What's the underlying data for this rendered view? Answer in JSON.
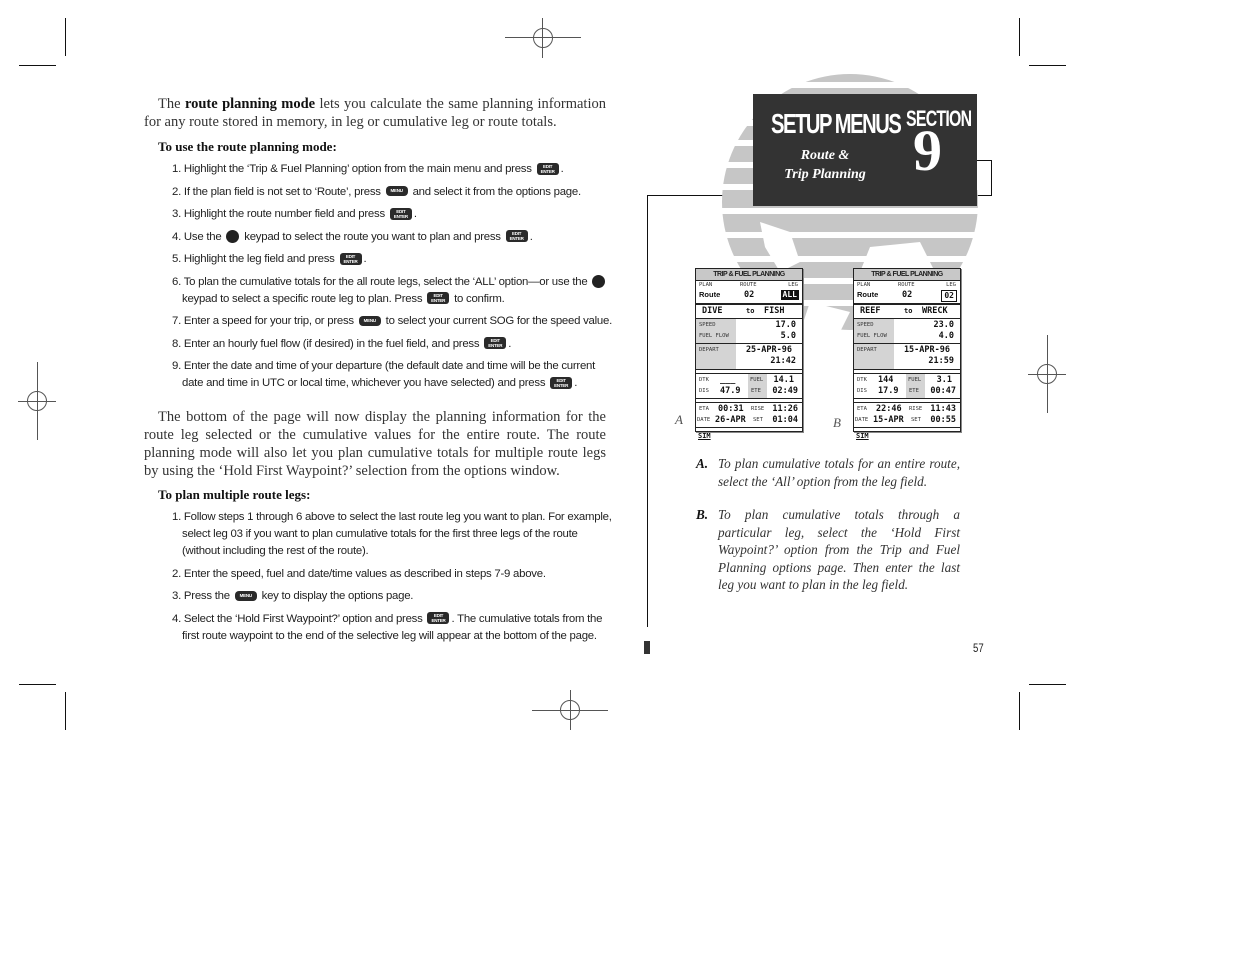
{
  "left_page": {
    "intro": {
      "prefix": "The ",
      "bold": "route planning mode",
      "suffix": " lets you calculate the same planning information for any route stored in memory, in leg or cumulative leg or route totals."
    },
    "use_heading": "To use the route planning mode:",
    "use_steps": [
      {
        "num": "1.",
        "parts": [
          "Highlight the ‘Trip & Fuel Planning’ option from the main menu and press ",
          "{EDIT}",
          "."
        ]
      },
      {
        "num": "2.",
        "parts": [
          "If the plan field is not set to ‘Route’, press ",
          "{MENU}",
          " and select it from the options page."
        ]
      },
      {
        "num": "3.",
        "parts": [
          "Highlight the route number field and press ",
          "{EDIT}",
          "."
        ]
      },
      {
        "num": "4.",
        "parts": [
          "Use the ",
          "{PAD}",
          " keypad to select the route you want to plan and press ",
          "{EDIT}",
          "."
        ]
      },
      {
        "num": "5.",
        "parts": [
          "Highlight the leg field and press ",
          "{EDIT}",
          "."
        ]
      },
      {
        "num": "6.",
        "parts": [
          "To plan the cumulative totals for the all route legs, select the ‘ALL’ option—or use the ",
          "{PAD}",
          " keypad to select a specific route leg to plan. Press ",
          "{EDIT}",
          " to confirm."
        ]
      },
      {
        "num": "7.",
        "parts": [
          "Enter a speed for your trip, or press ",
          "{MENU}",
          " to select your current SOG for the speed value."
        ]
      },
      {
        "num": "8.",
        "parts": [
          "Enter an hourly fuel flow (if desired) in the fuel field, and press ",
          "{EDIT}",
          "."
        ]
      },
      {
        "num": "9.",
        "parts": [
          "Enter the date and time of your departure (the default date and time will be the current date and time in UTC or local time, whichever you have selected) and press ",
          "{EDIT}",
          "."
        ]
      }
    ],
    "para2": "The bottom of the page will now display the planning information for the route leg selected or the cumulative values for the entire route. The route planning mode will also let you plan cumulative totals for multiple route legs by using the ‘Hold First Waypoint?’ selection from the options window.",
    "multi_heading": "To plan multiple route legs:",
    "multi_steps": [
      {
        "num": "1.",
        "parts": [
          "Follow steps 1 through 6 above to select the last route leg you want to plan. For example, select leg 03 if you want to plan cumulative totals for the first three legs of the route (without including the rest of the route)."
        ]
      },
      {
        "num": "2.",
        "parts": [
          "Enter the speed, fuel and date/time values as described in steps 7-9 above."
        ]
      },
      {
        "num": "3.",
        "parts": [
          "Press the ",
          "{MENU}",
          " key to display the options page."
        ]
      },
      {
        "num": "4.",
        "parts": [
          "Select the ‘Hold First Waypoint?’ option and press ",
          "{EDIT}",
          ". The cumulative totals from the first route waypoint to the end of the selective leg will appear at the bottom of the page."
        ]
      }
    ],
    "keys": {
      "edit_top": "EDIT",
      "edit_bottom": "ENTER",
      "menu": "MENU"
    }
  },
  "section_header": {
    "title": "SETUP MENUS",
    "subtitle_line1": "Route &",
    "subtitle_line2": "Trip Planning",
    "section_label": "SECTION",
    "section_number": "9"
  },
  "screens": [
    {
      "letter": "A",
      "title": "TRIP & FUEL PLANNING",
      "plan_label": "PLAN",
      "route_label": "ROUTE",
      "leg_label": "LEG",
      "plan_value": "Route",
      "route_value": "02",
      "leg_value": "ALL",
      "from": "DIVE",
      "to_word": "to",
      "to": "FISH",
      "speed_label": "SPEED",
      "speed_value": "17.0",
      "fuel_flow_label": "FUEL FLOW",
      "fuel_flow_value": "5.0",
      "depart_label": "DEPART",
      "depart_date": "25-APR-96",
      "depart_time": "21:42",
      "dtk_label": "DTK",
      "dtk_value": "___",
      "dis_label": "DIS",
      "dis_value": "47.9",
      "fuel_label": "FUEL",
      "fuel_value": "14.1",
      "ete_label": "ETE",
      "ete_value": "02:49",
      "eta_label": "ETA",
      "eta_value": "00:31",
      "date_label": "DATE",
      "date_value": "26-APR",
      "rise_label": "RISE",
      "rise_value": "11:26",
      "set_label": "SET",
      "set_value": "01:04",
      "status": "SIM"
    },
    {
      "letter": "B",
      "title": "TRIP & FUEL PLANNING",
      "plan_label": "PLAN",
      "route_label": "ROUTE",
      "leg_label": "LEG",
      "plan_value": "Route",
      "route_value": "02",
      "leg_value": "02",
      "from": "REEF",
      "to_word": "to",
      "to": "WRECK",
      "speed_label": "SPEED",
      "speed_value": "23.0",
      "fuel_flow_label": "FUEL FLOW",
      "fuel_flow_value": "4.0",
      "depart_label": "DEPART",
      "depart_date": "15-APR-96",
      "depart_time": "21:59",
      "dtk_label": "DTK",
      "dtk_value": "144",
      "dis_label": "DIS",
      "dis_value": "17.9",
      "fuel_label": "FUEL",
      "fuel_value": "3.1",
      "ete_label": "ETE",
      "ete_value": "00:47",
      "eta_label": "ETA",
      "eta_value": "22:46",
      "date_label": "DATE",
      "date_value": "15-APR",
      "rise_label": "RISE",
      "rise_value": "11:43",
      "set_label": "SET",
      "set_value": "00:55",
      "status": "SIM"
    }
  ],
  "captions": [
    {
      "letter": "A.",
      "text": "To plan cumulative totals for an entire route, select the ‘All’ option from the leg field."
    },
    {
      "letter": "B.",
      "text": "To plan cumulative totals through a particular leg, select the ‘Hold First Waypoint?’ option from the Trip and Fuel Planning options page. Then enter the last leg you want to plan in the leg field."
    }
  ],
  "page_number": "57",
  "colors": {
    "section_box": "#333333",
    "globe": "#c6c6c6",
    "screen_grey": "#d4d4d4"
  }
}
